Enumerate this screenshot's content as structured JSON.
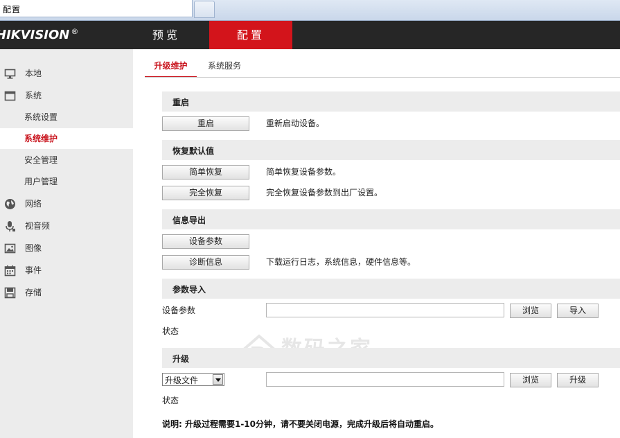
{
  "browser": {
    "tab_title": "配置"
  },
  "header": {
    "logo": "HIKVISION",
    "logo_reg": "®",
    "nav": {
      "preview": "预览",
      "config": "配置"
    }
  },
  "sidebar": {
    "items": [
      {
        "label": "本地",
        "icon": "monitor-icon"
      },
      {
        "label": "系统",
        "icon": "window-icon"
      },
      {
        "label": "系统设置"
      },
      {
        "label": "系统维护",
        "active": true
      },
      {
        "label": "安全管理"
      },
      {
        "label": "用户管理"
      },
      {
        "label": "网络",
        "icon": "globe-icon"
      },
      {
        "label": "视音频",
        "icon": "microphone-icon"
      },
      {
        "label": "图像",
        "icon": "image-icon"
      },
      {
        "label": "事件",
        "icon": "calendar-icon"
      },
      {
        "label": "存储",
        "icon": "disk-icon"
      }
    ]
  },
  "tabs": {
    "upgrade": "升级维护",
    "service": "系统服务"
  },
  "reboot": {
    "title": "重启",
    "button": "重启",
    "desc": "重新启动设备。"
  },
  "restore": {
    "title": "恢复默认值",
    "simple_button": "简单恢复",
    "simple_desc": "简单恢复设备参数。",
    "full_button": "完全恢复",
    "full_desc": "完全恢复设备参数到出厂设置。"
  },
  "export": {
    "title": "信息导出",
    "params_button": "设备参数",
    "diag_button": "诊断信息",
    "diag_desc": "下载运行日志，系统信息，硬件信息等。"
  },
  "import": {
    "title": "参数导入",
    "label": "设备参数",
    "file_value": "",
    "browse_button": "浏览",
    "import_button": "导入",
    "status_label": "状态"
  },
  "upgrade": {
    "title": "升级",
    "select_value": "升级文件",
    "file_value": "",
    "browse_button": "浏览",
    "upgrade_button": "升级",
    "status_label": "状态"
  },
  "note": "说明: 升级过程需要1-10分钟，请不要关闭电源，完成升级后将自动重启。",
  "watermark": {
    "cn": "数码之家",
    "en": "MYDIGIT.NET"
  },
  "colors": {
    "accent": "#d3141b",
    "header_bg": "#262626",
    "sidebar_bg": "#ececec",
    "active_text": "#c9151e"
  }
}
